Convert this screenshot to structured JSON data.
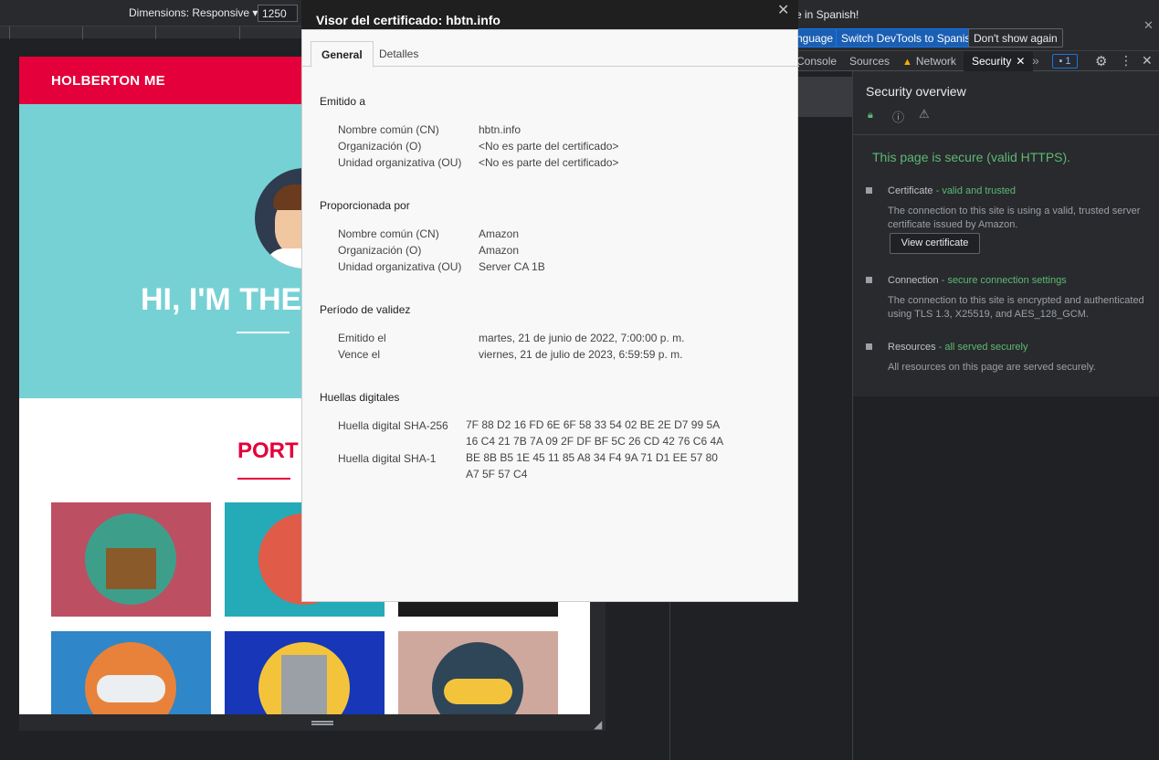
{
  "device_toolbar": {
    "dimensions_label": "Dimensions: Responsive ▾",
    "width_value": "1250"
  },
  "site": {
    "brand": "HOLBERTON ME",
    "hero_title": "HI, I'M THE",
    "portfolio_title": "PORT"
  },
  "devtools": {
    "infobar": {
      "text": "e in Spanish!",
      "btn_language": "nguage",
      "btn_switch": "Switch DevTools to Spanish",
      "btn_dont": "Don't show again"
    },
    "tabs": {
      "console": "Console",
      "sources": "Sources",
      "network": "Network",
      "security": "Security",
      "issues_count": "1"
    },
    "security": {
      "title": "Security overview",
      "secure_text": "This page is secure (valid HTTPS).",
      "certificate_label": "Certificate",
      "certificate_status": "- valid and trusted",
      "certificate_desc": "The connection to this site is using a valid, trusted server certificate issued by Amazon.",
      "view_certificate": "View certificate",
      "connection_label": "Connection",
      "connection_status": "- secure connection settings",
      "connection_desc": "The connection to this site is encrypted and authenticated using TLS 1.3, X25519, and AES_128_GCM.",
      "resources_label": "Resources",
      "resources_status": "- all served securely",
      "resources_desc": "All resources on this page are served securely."
    }
  },
  "cert": {
    "title": "Visor del certificado: hbtn.info",
    "tab_general": "General",
    "tab_details": "Detalles",
    "issued_to": {
      "heading": "Emitido a",
      "cn_label": "Nombre común (CN)",
      "cn": "hbtn.info",
      "o_label": "Organización (O)",
      "o": "<No es parte del certificado>",
      "ou_label": "Unidad organizativa (OU)",
      "ou": "<No es parte del certificado>"
    },
    "issued_by": {
      "heading": "Proporcionada por",
      "cn_label": "Nombre común (CN)",
      "cn": "Amazon",
      "o_label": "Organización (O)",
      "o": "Amazon",
      "ou_label": "Unidad organizativa (OU)",
      "ou": "Server CA 1B"
    },
    "validity": {
      "heading": "Período de validez",
      "issued_label": "Emitido el",
      "issued": "martes, 21 de junio de 2022, 7:00:00 p. m.",
      "expires_label": "Vence el",
      "expires": "viernes, 21 de julio de 2023, 6:59:59 p. m."
    },
    "fingerprints": {
      "heading": "Huellas digitales",
      "sha256_label": "Huella digital SHA-256",
      "sha256_line1": "7F 88 D2 16 FD 6E 6F 58 33 54 02 BE 2E D7 99 5A",
      "sha256_line2": "16 C4 21 7B 7A 09 2F DF BF 5C 26 CD 42 76 C6 4A",
      "sha1_label": "Huella digital SHA-1",
      "sha1_line1": "BE 8B B5 1E 45 11 85 A8 34 F4 9A 71 D1 EE 57 80",
      "sha1_line2": "A7 5F 57 C4"
    }
  },
  "colors": {
    "brand_red": "#e4003a",
    "hero_teal": "#76d1d5",
    "secure_green": "#5bb974"
  },
  "icons": [
    "close-icon",
    "lock-icon",
    "info-icon",
    "warning-icon",
    "gear-icon",
    "kebab-menu-icon",
    "chevron-double-right-icon",
    "issues-icon"
  ]
}
